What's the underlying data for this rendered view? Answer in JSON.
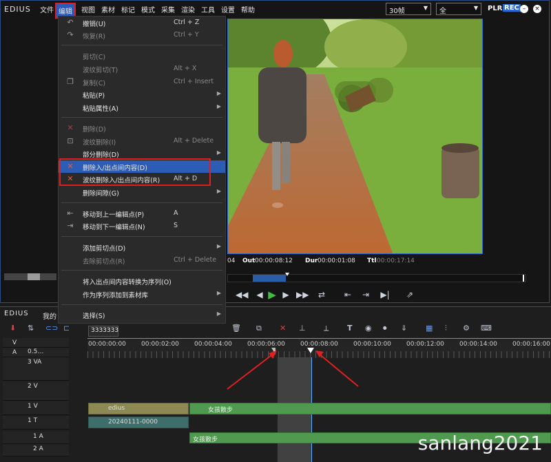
{
  "app": {
    "logo": "EDIUS",
    "logo2": "EDIUS",
    "project_short": "我的"
  },
  "menubar": {
    "items": [
      "文件",
      "编辑",
      "视图",
      "素材",
      "标记",
      "模式",
      "采集",
      "渲染",
      "工具",
      "设置",
      "帮助"
    ],
    "fps": "30帧",
    "zoom": "全",
    "plr": "PLR",
    "rec": "REC"
  },
  "edit_menu": {
    "items": [
      {
        "label": "撤销(U)",
        "shortcut": "Ctrl + Z",
        "enabled": true,
        "icon": "undo-icon"
      },
      {
        "label": "恢复(R)",
        "shortcut": "Ctrl + Y",
        "enabled": false,
        "icon": "redo-icon"
      },
      {
        "label": "剪切(C)",
        "shortcut": "",
        "enabled": false,
        "icon": ""
      },
      {
        "label": "波纹剪切(T)",
        "shortcut": "Alt + X",
        "enabled": false,
        "icon": ""
      },
      {
        "label": "复制(C)",
        "shortcut": "Ctrl + Insert",
        "enabled": false,
        "icon": "copy-icon"
      },
      {
        "label": "粘贴(P)",
        "shortcut": "",
        "enabled": true,
        "icon": "",
        "submenu": true
      },
      {
        "label": "粘贴属性(A)",
        "shortcut": "",
        "enabled": true,
        "icon": "",
        "submenu": true
      },
      {
        "label": "删除(D)",
        "shortcut": "",
        "enabled": false,
        "icon": "delete-icon"
      },
      {
        "label": "波纹删除(I)",
        "shortcut": "Alt + Delete",
        "enabled": false,
        "icon": "ripple-delete-icon"
      },
      {
        "label": "部分删除(D)",
        "shortcut": "",
        "enabled": true,
        "icon": "",
        "submenu": true
      },
      {
        "label": "删除入/出点间内容(D)",
        "shortcut": "",
        "enabled": true,
        "icon": "delete-inout-icon",
        "highlighted": true
      },
      {
        "label": "波纹删除入/出点间内容(R)",
        "shortcut": "Alt + D",
        "enabled": true,
        "icon": "ripple-delete-inout-icon"
      },
      {
        "label": "删除间隙(G)",
        "shortcut": "",
        "enabled": true,
        "icon": "",
        "submenu": true
      },
      {
        "label": "移动到上一编辑点(P)",
        "shortcut": "A",
        "enabled": true,
        "icon": "prev-edit-icon"
      },
      {
        "label": "移动到下一编辑点(N)",
        "shortcut": "S",
        "enabled": true,
        "icon": "next-edit-icon"
      },
      {
        "label": "添加剪切点(D)",
        "shortcut": "",
        "enabled": true,
        "icon": "",
        "submenu": true
      },
      {
        "label": "去除剪切点(R)",
        "shortcut": "Ctrl + Delete",
        "enabled": false,
        "icon": ""
      },
      {
        "label": "将入出点间内容转换为序列(O)",
        "shortcut": "",
        "enabled": true,
        "icon": ""
      },
      {
        "label": "作为序列添加到素材库",
        "shortcut": "",
        "enabled": true,
        "icon": "",
        "submenu": true
      },
      {
        "label": "选择(S)",
        "shortcut": "",
        "enabled": true,
        "icon": "",
        "submenu": true
      }
    ]
  },
  "timecodes": {
    "cur_prefix": "04",
    "out_label": "Out",
    "out_value": "00:00:08:12",
    "dur_label": "Dur",
    "dur_value": "00:00:01:08",
    "ttl_label": "Ttl",
    "ttl_value": "00:00:17:14"
  },
  "timeline": {
    "sequence_tab": "3333333",
    "zoom_label": "0.5…",
    "ruler": [
      "00:00:00:00",
      "00:00:02:00",
      "00:00:04:00",
      "00:00:06:00",
      "00:00:08:00",
      "00:00:10:00",
      "00:00:12:00",
      "00:00:14:00",
      "00:00:16:00"
    ],
    "tracks": [
      {
        "name": "V"
      },
      {
        "name": "A"
      },
      {
        "name": "3 VA"
      },
      {
        "name": "2 V"
      },
      {
        "name": "1 V"
      },
      {
        "name": "1 T"
      },
      {
        "name": "1 A"
      },
      {
        "name": "2 A"
      }
    ],
    "clips": {
      "edius_clip": "edius",
      "video_clip": "女孩散步",
      "title_clip": "20240111-0000",
      "audio_clip": "女孩散步"
    }
  },
  "watermark": "sanlang2021",
  "colors": {
    "accent_blue": "#2b6ad0",
    "highlight_red": "#e02020",
    "clip_green": "#4f9a4f",
    "clip_olive": "#8c8a52",
    "title_teal": "#3d6e6a",
    "inout_region": "#555555"
  }
}
